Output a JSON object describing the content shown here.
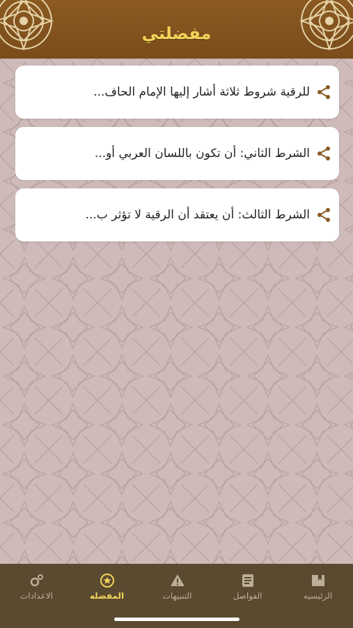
{
  "header": {
    "title": "مفضلتي"
  },
  "favorites": [
    {
      "text": "للرقية شروط ثلاثة أشار إليها الإمام الحاف...",
      "icon": "share-icon"
    },
    {
      "text": "الشرط الثاني: أن تكون باللسان العربي أو...",
      "icon": "share-icon"
    },
    {
      "text": "الشرط الثالث: أن يعتقد أن الرقية لا تؤثر ب...",
      "icon": "share-icon"
    }
  ],
  "tabbar": {
    "tabs": [
      {
        "label": "الرئيسيه",
        "icon": "book-icon",
        "active": false
      },
      {
        "label": "الفواصل",
        "icon": "bookmark-note-icon",
        "active": false
      },
      {
        "label": "التنبيهات",
        "icon": "warning-icon",
        "active": false
      },
      {
        "label": "المفضله",
        "icon": "star-circle-icon",
        "active": true
      },
      {
        "label": "الاعدادات",
        "icon": "settings-icon",
        "active": false
      }
    ]
  },
  "colors": {
    "header_bg": "#7a4c1a",
    "title": "#f3d35a",
    "page_bg": "#cdbab9",
    "share_icon": "#8a5a26",
    "tabbar_bg": "#5a4a30",
    "tab_active": "#f3d35a",
    "tab_inactive": "#bcae98"
  }
}
